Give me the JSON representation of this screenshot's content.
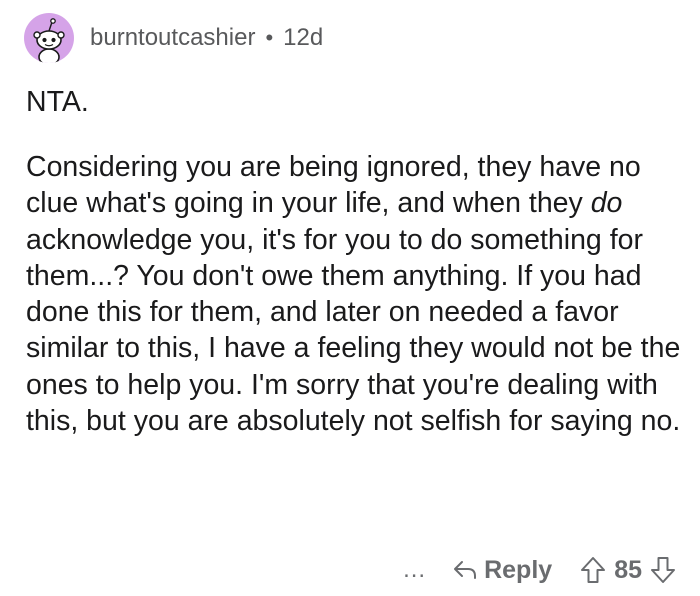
{
  "comment": {
    "author": "burntoutcashier",
    "separator": "•",
    "age": "12d",
    "paragraph1": "NTA.",
    "paragraph2": {
      "before_italic": "Considering you are being ignored, they have no clue what's going in your life, and when they ",
      "italic": "do",
      "after_italic": " acknowledge you, it's for you to do something for them...? You don't owe them anything. If you had done this for them, and later on needed a favor similar to this, I have a feeling they would not be the ones to help you. I'm sorry that you're dealing with this, but you are absolutely not selfish for saying no."
    }
  },
  "actions": {
    "more_label": "...",
    "reply_label": "Reply",
    "score": "85"
  },
  "icons": {
    "avatar": "snoo-avatar-icon",
    "more": "more-options-icon",
    "reply": "reply-arrow-icon",
    "upvote": "upvote-arrow-icon",
    "downvote": "downvote-arrow-icon"
  },
  "colors": {
    "avatar_bg": "#d5a3e8",
    "meta_text": "#58595b",
    "body_text": "#1a1a1b",
    "action_text": "#6a6c6f"
  }
}
